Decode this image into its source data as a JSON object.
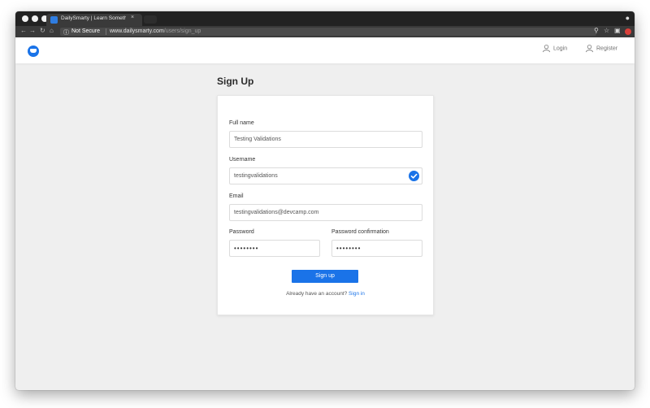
{
  "browser": {
    "tab_title": "DailySmarty | Learn Somethin",
    "tab_close": "×",
    "omnibox": {
      "security_label": "Not Secure",
      "host": "www.dailysmarty.com",
      "path": "/users/sign_up"
    },
    "nav_icons": [
      "back-icon",
      "forward-icon",
      "reload-icon",
      "home-icon"
    ]
  },
  "header": {
    "login_label": "Login",
    "register_label": "Register"
  },
  "page": {
    "title": "Sign Up"
  },
  "form": {
    "full_name": {
      "label": "Full name",
      "value": "Testing Validations"
    },
    "username": {
      "label": "Username",
      "value": "testingvalidations",
      "valid": true
    },
    "email": {
      "label": "Email",
      "value": "testingvalidations@devcamp.com"
    },
    "password": {
      "label": "Password",
      "value": "••••••••"
    },
    "password_confirmation": {
      "label": "Password confirmation",
      "value": "••••••••"
    },
    "submit_label": "Sign up",
    "account_prompt": "Already have an account?",
    "signin_link": "Sign in"
  },
  "colors": {
    "accent": "#1a73e8",
    "background": "#efefef"
  }
}
